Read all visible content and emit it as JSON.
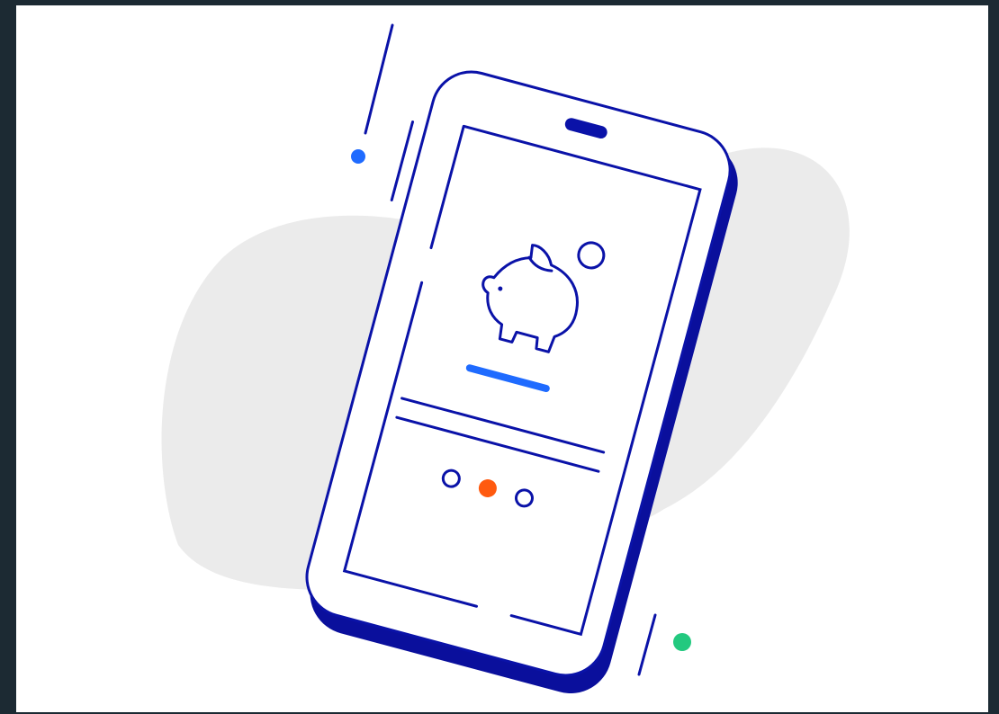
{
  "illustration": {
    "subject": "phone-piggy-bank-illustration",
    "icons": [
      "phone-icon",
      "piggy-bank-icon",
      "coin-icon"
    ],
    "carousel": {
      "dots": 3,
      "active_index": 1
    }
  },
  "colors": {
    "frame_background": "#1c2a33",
    "card_background": "#ffffff",
    "blob": "#ebebeb",
    "outline": "#0a12a8",
    "phone_shadow": "#0a0f9c",
    "accent_blue": "#1f6bff",
    "accent_orange": "#ff5a0f",
    "accent_green": "#23c97f"
  }
}
